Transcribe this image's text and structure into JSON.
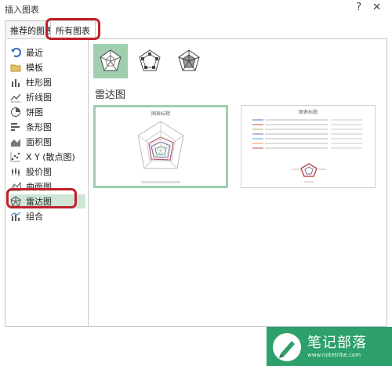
{
  "window": {
    "title": "插入图表",
    "help": "?",
    "close": "✕"
  },
  "tabs": [
    {
      "label": "推荐的图表"
    },
    {
      "label": "所有图表"
    }
  ],
  "sidebar": {
    "items": [
      {
        "label": "最近",
        "icon": "undo-icon"
      },
      {
        "label": "模板",
        "icon": "folder-icon"
      },
      {
        "label": "柱形图",
        "icon": "column-chart-icon"
      },
      {
        "label": "折线图",
        "icon": "line-chart-icon"
      },
      {
        "label": "饼图",
        "icon": "pie-chart-icon"
      },
      {
        "label": "条形图",
        "icon": "bar-chart-icon"
      },
      {
        "label": "面积图",
        "icon": "area-chart-icon"
      },
      {
        "label": "X Y (散点图)",
        "icon": "scatter-chart-icon"
      },
      {
        "label": "股价图",
        "icon": "stock-chart-icon"
      },
      {
        "label": "曲面图",
        "icon": "surface-chart-icon"
      },
      {
        "label": "雷达图",
        "icon": "radar-chart-icon"
      },
      {
        "label": "组合",
        "icon": "combo-chart-icon"
      }
    ],
    "selected_index": 10
  },
  "main": {
    "section_title": "雷达图",
    "subtypes": [
      "radar",
      "radar-with-markers",
      "filled-radar"
    ],
    "preview_titles": [
      "图表标题",
      "图表标题"
    ]
  },
  "watermark": {
    "text": "笔记部落",
    "url": "www.notetribe.com",
    "suffix": ".net"
  },
  "colors": {
    "accent": "#9fcfae",
    "highlight": "#c0202a",
    "watermark": "#2da06c"
  }
}
